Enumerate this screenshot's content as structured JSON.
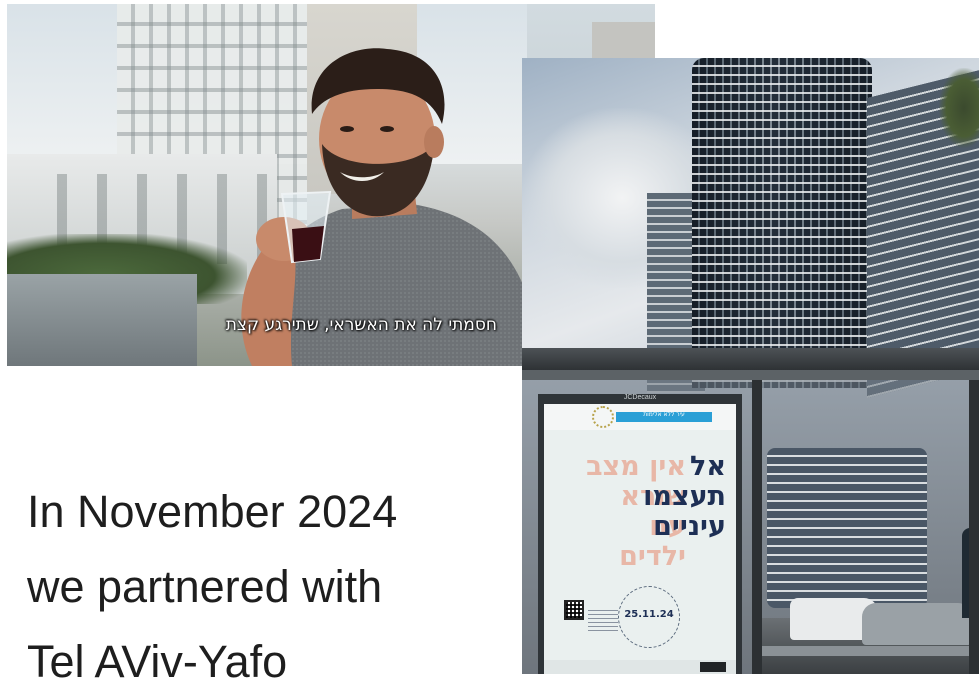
{
  "caption": {
    "line1": "In November 2024",
    "line2": "we partnered with",
    "line3": "Tel AViv-Yafo"
  },
  "photo1": {
    "subtitle": "חסמתי לה את האשראי, שתירגע קצת"
  },
  "photo2": {
    "shelter_brand": "JCDecaux",
    "poster": {
      "header_band": "עיר ללא אלימות",
      "headline_front": [
        "אל",
        "תעצמו",
        "עיניים"
      ],
      "headline_back": [
        "אין מצב",
        "שורא",
        "עם",
        "ילדים"
      ],
      "date": "25.11.24"
    }
  },
  "colors": {
    "caption_text": "#1e1e1e",
    "poster_headline": "#1d2f55",
    "poster_headline_back": "#e8b7a7",
    "poster_band": "#2a9fd6"
  }
}
